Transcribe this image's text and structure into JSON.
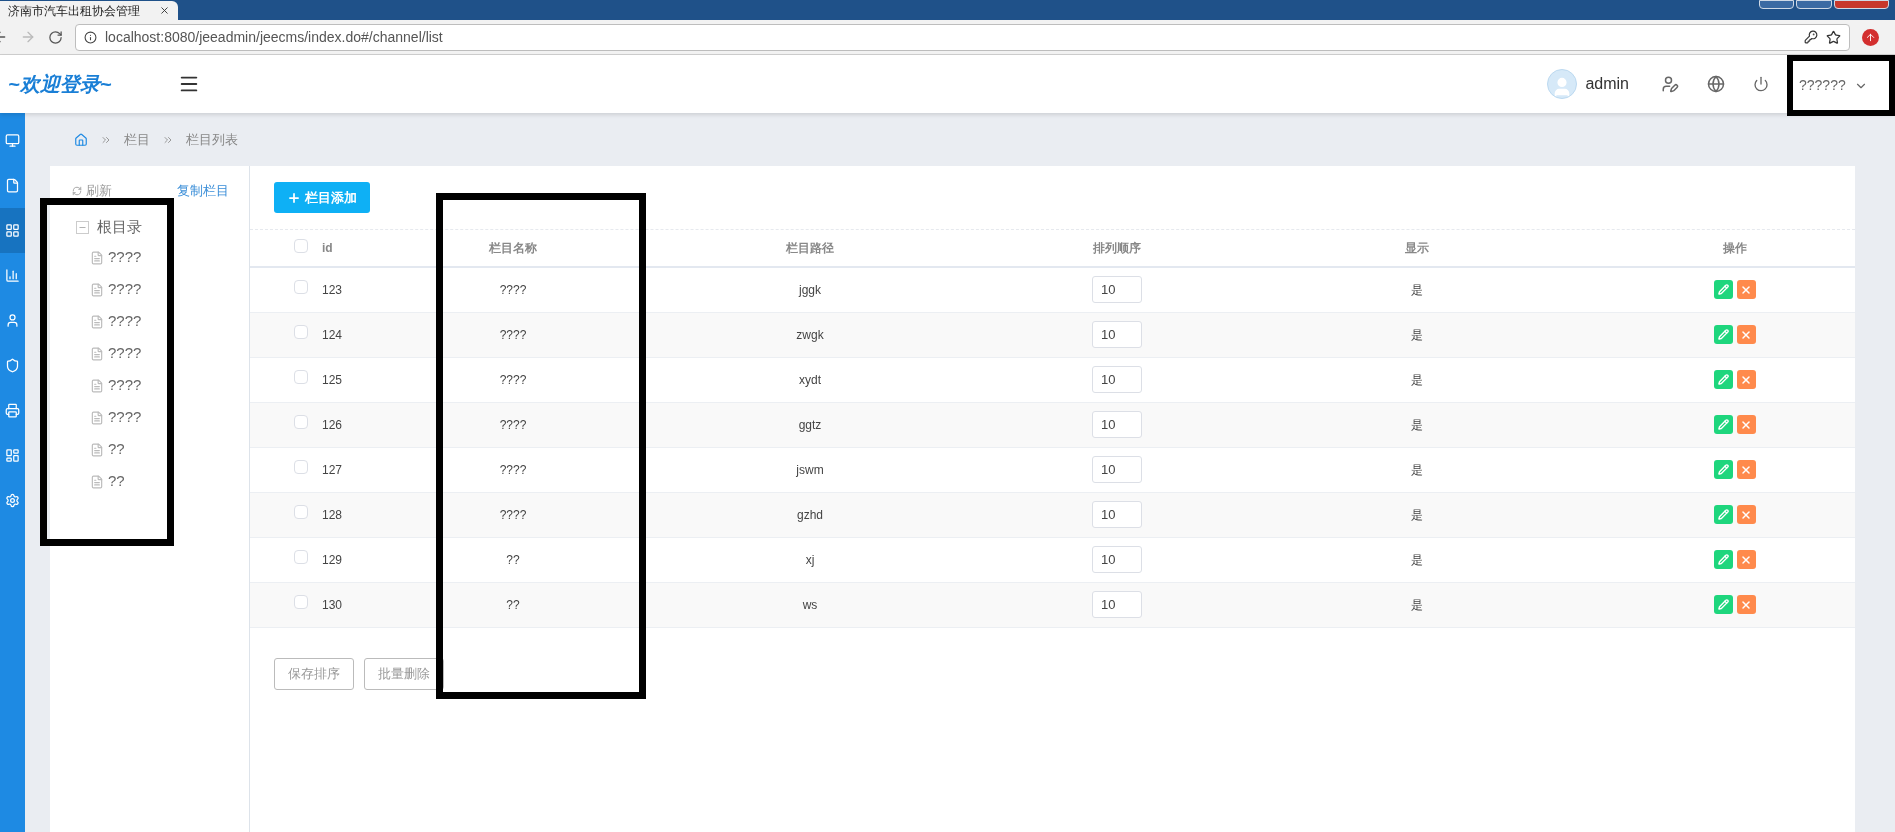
{
  "browser": {
    "tab_title": "济南市汽车出租协会管理",
    "url": "localhost:8080/jeeadmin/jeecms/index.do#/channel/list"
  },
  "header": {
    "logo": "~欢迎登录~",
    "user": "admin",
    "language": "??????"
  },
  "sidebar": {
    "items": [
      {
        "selected": false
      },
      {
        "selected": false
      },
      {
        "selected": true
      },
      {
        "selected": false
      },
      {
        "selected": false
      },
      {
        "selected": false
      },
      {
        "selected": false
      },
      {
        "selected": false
      },
      {
        "selected": false
      }
    ]
  },
  "breadcrumb": [
    "栏目",
    "栏目列表"
  ],
  "tree_toolbar": {
    "refresh": "刷新",
    "copy": "复制栏目"
  },
  "tree": {
    "label": "根目录",
    "expanded": true,
    "children": [
      {
        "label": "????"
      },
      {
        "label": "????"
      },
      {
        "label": "????"
      },
      {
        "label": "????"
      },
      {
        "label": "????"
      },
      {
        "label": "????"
      },
      {
        "label": "??"
      },
      {
        "label": "??"
      }
    ]
  },
  "add_button": "栏目添加",
  "table": {
    "select_all": false,
    "columns": [
      "id",
      "栏目名称",
      "栏目路径",
      "排列顺序",
      "显示",
      "操作"
    ],
    "rows": [
      {
        "checked": false,
        "id": "123",
        "name": "????",
        "path": "jggk",
        "order": "10",
        "display": "是"
      },
      {
        "checked": false,
        "id": "124",
        "name": "????",
        "path": "zwgk",
        "order": "10",
        "display": "是"
      },
      {
        "checked": false,
        "id": "125",
        "name": "????",
        "path": "xydt",
        "order": "10",
        "display": "是"
      },
      {
        "checked": false,
        "id": "126",
        "name": "????",
        "path": "ggtz",
        "order": "10",
        "display": "是"
      },
      {
        "checked": false,
        "id": "127",
        "name": "????",
        "path": "jswm",
        "order": "10",
        "display": "是"
      },
      {
        "checked": false,
        "id": "128",
        "name": "????",
        "path": "gzhd",
        "order": "10",
        "display": "是"
      },
      {
        "checked": false,
        "id": "129",
        "name": "??",
        "path": "xj",
        "order": "10",
        "display": "是"
      },
      {
        "checked": false,
        "id": "130",
        "name": "??",
        "path": "ws",
        "order": "10",
        "display": "是"
      }
    ]
  },
  "footer_buttons": [
    "保存排序",
    "批量删除"
  ]
}
